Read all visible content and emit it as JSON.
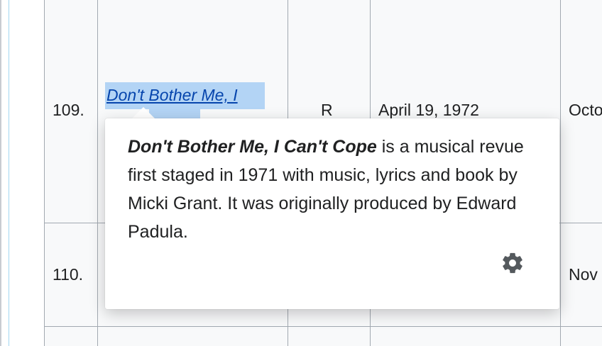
{
  "rows": [
    {
      "number": "109.",
      "title_visible": "Don't Bother Me, I",
      "rating": "R",
      "date": "April 19, 1972",
      "next_col": "Octo"
    },
    {
      "number": "110.",
      "next_col": "Nov"
    }
  ],
  "popup": {
    "bold_title": "Don't Bother Me, I Can't Cope",
    "description": " is a musical revue first staged in 1971 with music, lyrics and book by Micki Grant. It was originally produced by Edward Padula.",
    "settings_icon": "gear-icon"
  },
  "colors": {
    "link": "#0645ad",
    "link_highlight": "#b3d4f5",
    "cell_bg": "#f8f9fa",
    "border": "#a2a9b1"
  }
}
